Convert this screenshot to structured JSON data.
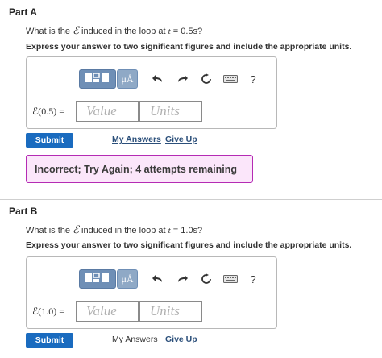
{
  "part_a": {
    "title": "Part A",
    "question_prefix": "What is the",
    "emf_symbol": "ℰ",
    "question_mid": " induced in the loop at ",
    "t_var": "t",
    "question_suffix": " = 0.5s?",
    "instruction": "Express your answer to two significant figures and include the appropriate units.",
    "equation_label": "ℰ(0.5) =",
    "value_placeholder": "Value",
    "units_placeholder": "Units",
    "submit_label": "Submit",
    "my_answers_label": "My Answers",
    "give_up_label": "Give Up",
    "feedback": "Incorrect; Try Again; 4 attempts remaining"
  },
  "part_b": {
    "title": "Part B",
    "question_prefix": "What is the",
    "emf_symbol": "ℰ",
    "question_mid": " induced in the loop at ",
    "t_var": "t",
    "question_suffix": " = 1.0s?",
    "instruction": "Express your answer to two significant figures and include the appropriate units.",
    "equation_label": "ℰ(1.0) =",
    "value_placeholder": "Value",
    "units_placeholder": "Units",
    "submit_label": "Submit",
    "my_answers_label": "My Answers",
    "give_up_label": "Give Up"
  },
  "toolbar": {
    "units_label": "μÅ",
    "help_label": "?",
    "icons": [
      "templates-icon",
      "units-icon",
      "undo-icon",
      "redo-icon",
      "reset-icon",
      "keyboard-icon",
      "help-icon"
    ]
  },
  "colors": {
    "submit": "#1a6bbf",
    "toolbar_dark": "#6f8fb6",
    "toolbar_light": "#8fa9c6",
    "feedback_border": "#b52bb4",
    "feedback_bg": "#fbe6fa",
    "link": "#2b4f7a"
  }
}
